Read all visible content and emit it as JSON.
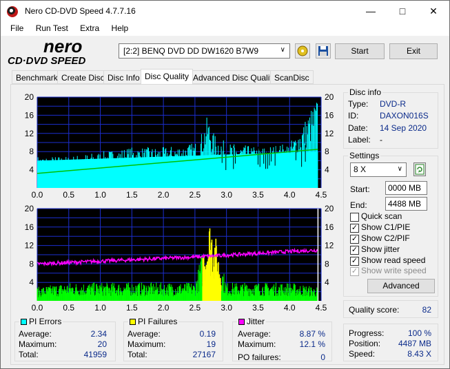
{
  "window": {
    "title": "Nero CD-DVD Speed 4.7.7.16"
  },
  "menu": [
    "File",
    "Run Test",
    "Extra",
    "Help"
  ],
  "toolbar": {
    "drive": "[2:2]   BENQ DVD DD DW1620 B7W9",
    "start_label": "Start",
    "exit_label": "Exit",
    "logo_text_1": "nero",
    "logo_text_2": "CD·DVD SPEED"
  },
  "tabs": [
    "Benchmark",
    "Create Disc",
    "Disc Info",
    "Disc Quality",
    "Advanced Disc Quality",
    "ScanDisc"
  ],
  "active_tab": "Disc Quality",
  "disc_info": {
    "title": "Disc info",
    "rows": [
      {
        "label": "Type:",
        "value": "DVD-R"
      },
      {
        "label": "ID:",
        "value": "DAXON016S"
      },
      {
        "label": "Date:",
        "value": "14 Sep 2020"
      },
      {
        "label": "Label:",
        "value": "-"
      }
    ]
  },
  "settings": {
    "title": "Settings",
    "speed": "8 X",
    "start_label": "Start:",
    "start_value": "0000 MB",
    "end_label": "End:",
    "end_value": "4488 MB",
    "checks": [
      {
        "label": "Quick scan",
        "checked": false,
        "enabled": true
      },
      {
        "label": "Show C1/PIE",
        "checked": true,
        "enabled": true
      },
      {
        "label": "Show C2/PIF",
        "checked": true,
        "enabled": true
      },
      {
        "label": "Show jitter",
        "checked": true,
        "enabled": true
      },
      {
        "label": "Show read speed",
        "checked": true,
        "enabled": true
      },
      {
        "label": "Show write speed",
        "checked": true,
        "enabled": false
      }
    ],
    "advanced_label": "Advanced"
  },
  "quality": {
    "label": "Quality score:",
    "value": "82"
  },
  "progress": {
    "rows": [
      {
        "label": "Progress:",
        "value": "100 %"
      },
      {
        "label": "Position:",
        "value": "4487 MB"
      },
      {
        "label": "Speed:",
        "value": "8.43 X"
      }
    ]
  },
  "stats": {
    "pi_errors": {
      "title": "PI Errors",
      "color": "#00ffff",
      "average": "2.34",
      "maximum": "20",
      "total": "41959"
    },
    "pi_failures": {
      "title": "PI Failures",
      "color": "#ffff00",
      "average": "0.19",
      "maximum": "19",
      "total": "27167"
    },
    "jitter": {
      "title": "Jitter",
      "color": "#ff00ff",
      "average": "8.87 %",
      "maximum": "12.1 %",
      "po_label": "PO failures:",
      "po_value": "0"
    },
    "labels": {
      "average": "Average:",
      "maximum": "Maximum:",
      "total": "Total:"
    }
  },
  "chart_data": [
    {
      "type": "area",
      "series": [
        {
          "name": "PI Errors",
          "color": "#00ffff"
        },
        {
          "name": "Read speed",
          "color": "#00c000"
        }
      ],
      "x_ticks": [
        "0.0",
        "0.5",
        "1.0",
        "1.5",
        "2.0",
        "2.5",
        "3.0",
        "3.5",
        "4.0",
        "4.5"
      ],
      "y_ticks_left": [
        "20",
        "16",
        "12",
        "8",
        "4"
      ],
      "y_ticks_right": [
        "20",
        "16",
        "12",
        "8",
        "4"
      ],
      "xlim": [
        0,
        4.5
      ],
      "ylim": [
        0,
        20
      ],
      "pi_errors_envelope": {
        "x": [
          0,
          0.5,
          1.0,
          1.5,
          2.0,
          2.5,
          2.6,
          2.7,
          2.8,
          3.0,
          3.5,
          4.0,
          4.2,
          4.4,
          4.45
        ],
        "y": [
          7,
          7,
          8,
          9,
          9,
          10,
          12,
          16,
          12,
          10,
          9,
          10,
          14,
          19,
          20
        ]
      },
      "read_speed": {
        "x": [
          0,
          4.45
        ],
        "y": [
          3.2,
          8.5
        ]
      }
    },
    {
      "type": "area",
      "series": [
        {
          "name": "PI Failures",
          "color": "#00ff00"
        },
        {
          "name": "PI Failures peak",
          "color": "#ffff00"
        },
        {
          "name": "Jitter",
          "color": "#ff00ff"
        }
      ],
      "x_ticks": [
        "0.0",
        "0.5",
        "1.0",
        "1.5",
        "2.0",
        "2.5",
        "3.0",
        "3.5",
        "4.0",
        "4.5"
      ],
      "y_ticks_left": [
        "20",
        "16",
        "12",
        "8",
        "4"
      ],
      "y_ticks_right": [
        "20",
        "16",
        "12",
        "8",
        "4"
      ],
      "xlim": [
        0,
        4.5
      ],
      "ylim": [
        0,
        20
      ],
      "pi_failures_envelope": {
        "x": [
          0,
          0.5,
          1.0,
          1.5,
          2.0,
          2.5,
          2.7,
          2.75,
          2.8,
          2.85,
          3.0,
          3.5,
          4.0,
          4.45
        ],
        "y": [
          3,
          4,
          4,
          4,
          4,
          4,
          16,
          19,
          17,
          12,
          4,
          4,
          4,
          3
        ]
      },
      "jitter": {
        "x": [
          0,
          0.5,
          1.0,
          1.5,
          2.0,
          2.5,
          3.0,
          3.5,
          4.0,
          4.45
        ],
        "y": [
          8.0,
          8.3,
          8.6,
          8.9,
          9.2,
          9.5,
          9.9,
          10.3,
          10.7,
          11.0
        ]
      }
    }
  ]
}
